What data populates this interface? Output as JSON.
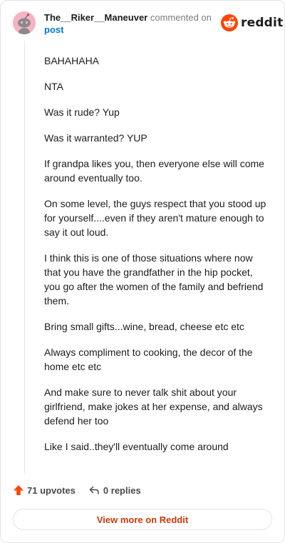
{
  "header": {
    "username": "The__Riker__Maneuver",
    "action_text": "commented on",
    "post_link": "post",
    "logo_text": "reddit"
  },
  "comment": {
    "paragraphs": [
      "BAHAHAHA",
      "NTA",
      "Was it rude? Yup",
      "Was it warranted? YUP",
      "If grandpa likes you, then everyone else will come around eventually too.",
      "On some level, the guys respect that you stood up for yourself....even if they aren't mature enough to say it out loud.",
      "I think this is one of those situations where now that you have the grandfather in the hip pocket, you go after the women of the family and befriend them.",
      "Bring small gifts...wine, bread, cheese etc etc",
      "Always compliment to cooking, the decor of the home etc etc",
      "And make sure to never talk shit about your girlfriend, make jokes at her expense, and always defend her too",
      "Like I said..they'll eventually come around"
    ]
  },
  "footer": {
    "upvotes_label": "71 upvotes",
    "replies_label": "0 replies",
    "view_more_label": "View more on Reddit"
  },
  "colors": {
    "upvote": "#ff4500",
    "link": "#0079d3",
    "view_more": "#c93a0a",
    "avatar_bg": "#f6b3c4"
  },
  "icons": {
    "avatar": "snoo-avatar-icon",
    "logo": "reddit-logo-icon",
    "upvote": "upvote-arrow-icon",
    "reply": "reply-arrow-icon"
  }
}
